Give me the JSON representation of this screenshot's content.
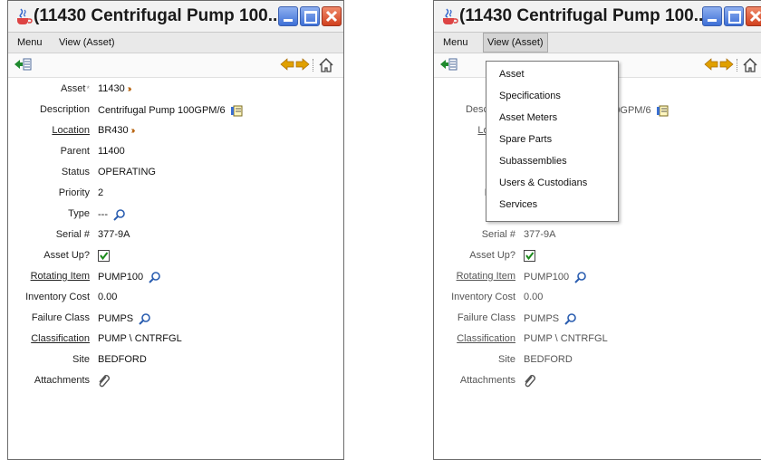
{
  "window_title": "(11430 Centrifugal Pump 100...",
  "menu": {
    "menu_label": "Menu",
    "view_label": "View (Asset)"
  },
  "view_menu_items": [
    "Asset",
    "Specifications",
    "Asset Meters",
    "Spare Parts",
    "Subassemblies",
    "Users & Custodians",
    "Services"
  ],
  "fields": [
    {
      "label": "Asset",
      "required": "*",
      "value": "11430"
    },
    {
      "label": "Description",
      "value": "Centrifugal Pump 100GPM/6"
    },
    {
      "label": "Location",
      "value": "BR430"
    },
    {
      "label": "Parent",
      "value": "11400"
    },
    {
      "label": "Status",
      "value": "OPERATING"
    },
    {
      "label": "Priority",
      "value": "2"
    },
    {
      "label": "Type",
      "value": "---"
    },
    {
      "label": "Serial #",
      "value": "377-9A"
    },
    {
      "label": "Asset Up?",
      "value": "checked"
    },
    {
      "label": "Rotating Item",
      "value": "PUMP100"
    },
    {
      "label": "Inventory Cost",
      "value": "0.00"
    },
    {
      "label": "Failure Class",
      "value": "PUMPS"
    },
    {
      "label": "Classification",
      "value": "PUMP \\ CNTRFGL"
    },
    {
      "label": "Site",
      "value": "BEDFORD"
    },
    {
      "label": "Attachments",
      "value": ""
    }
  ],
  "colors": {
    "accent_blue": "#3d6fd6",
    "close_red": "#d1401e",
    "nav_arrow": "#e0a000"
  }
}
